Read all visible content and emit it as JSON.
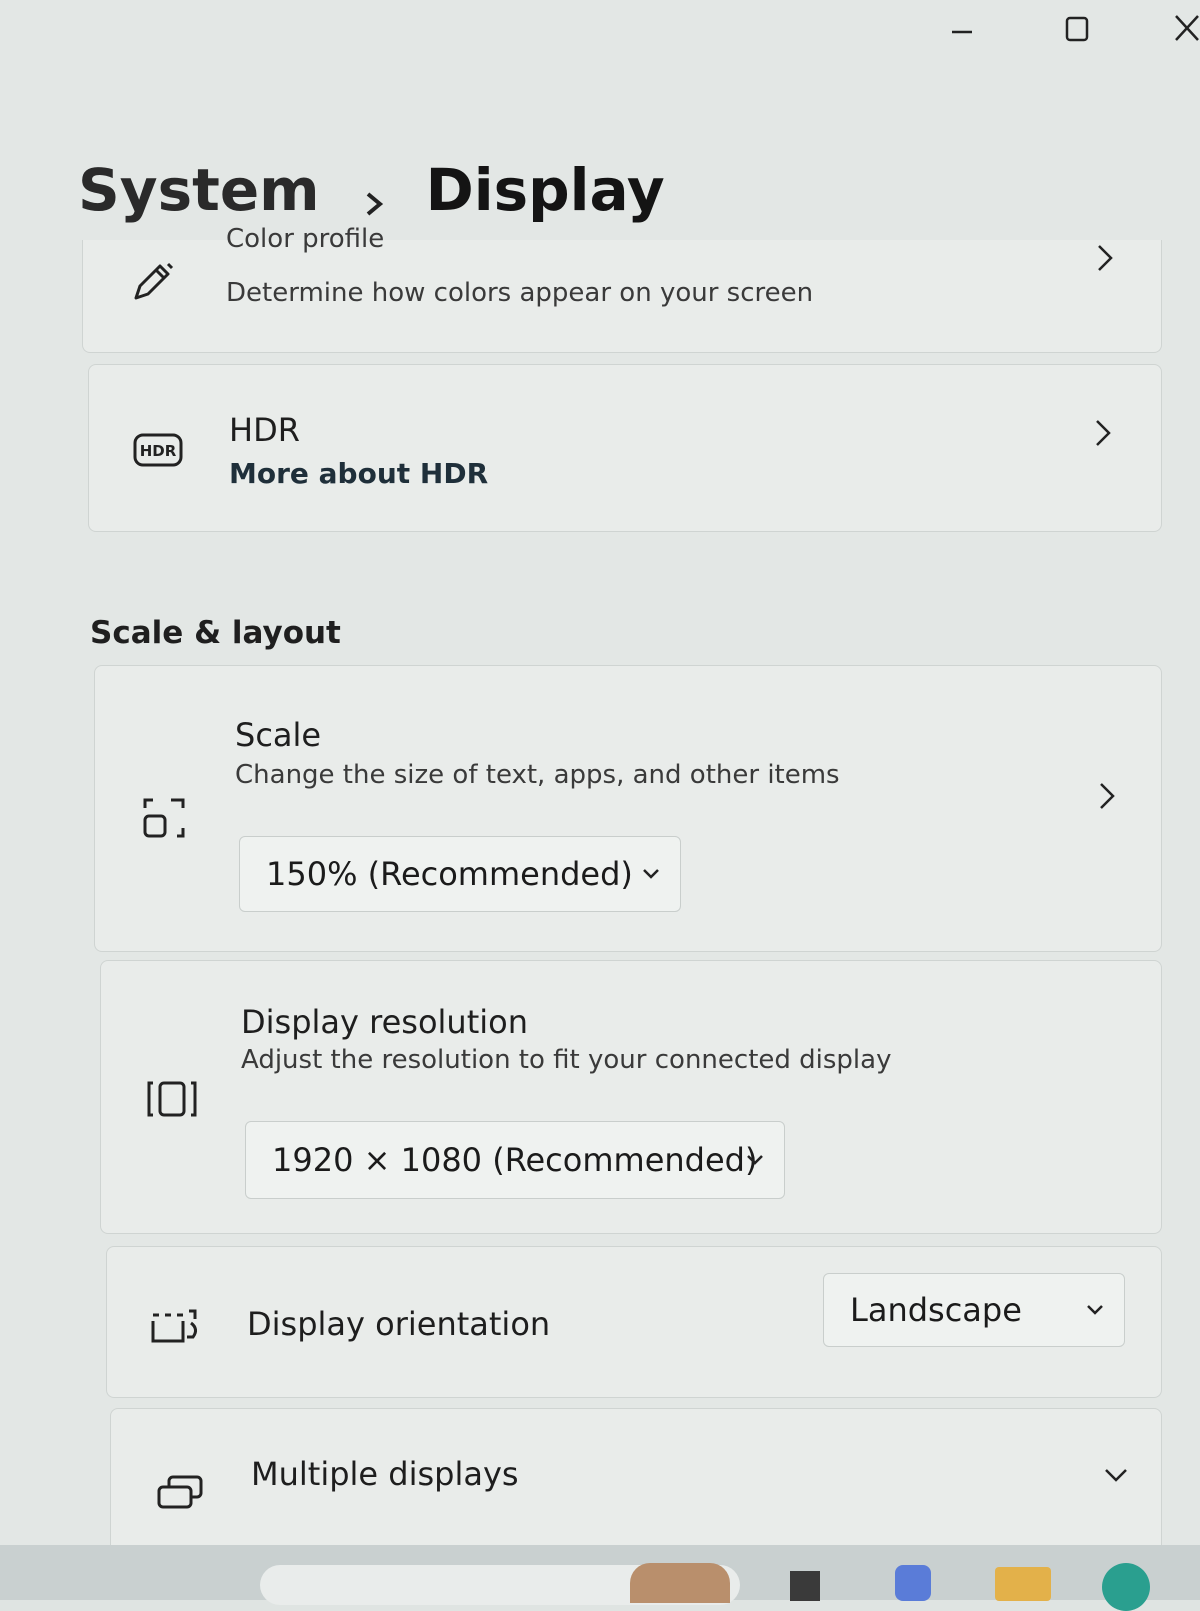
{
  "window": {
    "controls": {
      "minimize_icon": "minimize-icon",
      "maximize_icon": "maximize-icon",
      "close_icon": "close-icon"
    }
  },
  "breadcrumb": {
    "parent": "System",
    "current": "Display"
  },
  "color_profile": {
    "title": "Color profile",
    "description": "Determine how colors appear on your screen",
    "icon": "pen-icon"
  },
  "hdr": {
    "title": "HDR",
    "link": "More about HDR",
    "icon": "hdr-icon",
    "icon_text": "HDR"
  },
  "scale_layout": {
    "header": "Scale & layout",
    "scale": {
      "title": "Scale",
      "description": "Change the size of text, apps, and other items",
      "value": "150% (Recommended)",
      "icon": "scale-icon"
    },
    "resolution": {
      "title": "Display resolution",
      "description": "Adjust the resolution to fit your connected display",
      "value": "1920 × 1080 (Recommended)",
      "icon": "resolution-icon"
    },
    "orientation": {
      "title": "Display orientation",
      "value": "Landscape",
      "icon": "orientation-icon"
    },
    "multiple": {
      "title": "Multiple displays",
      "icon": "multiple-displays-icon"
    }
  },
  "colors": {
    "background": "#e3e7e5",
    "card": "#e9ecea",
    "text": "#1b1b1b"
  }
}
